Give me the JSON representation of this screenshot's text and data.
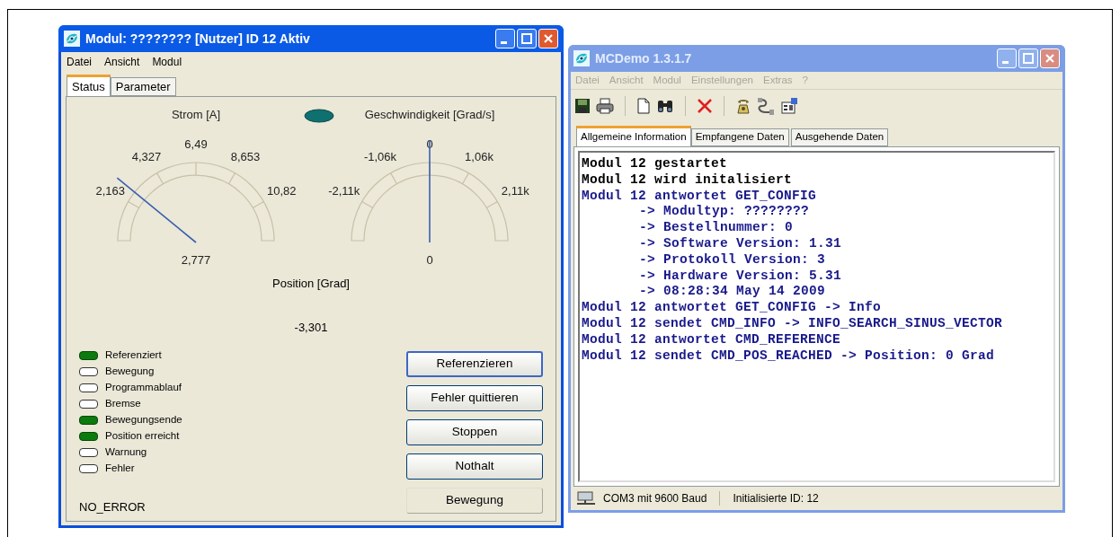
{
  "module_window": {
    "title": "Modul: ???????? [Nutzer] ID 12 Aktiv",
    "menu": [
      "Datei",
      "Ansicht",
      "Modul"
    ],
    "tabs": [
      {
        "label": "Status",
        "selected": true
      },
      {
        "label": "Parameter",
        "selected": false
      }
    ],
    "gauges": [
      {
        "title": "Strom [A]",
        "ticks": [
          "2,163",
          "4,327",
          "6,49",
          "8,653",
          "10,82"
        ],
        "value": "2,777",
        "level": 0.214
      },
      {
        "title": "Geschwindigkeit [Grad/s]",
        "ticks": [
          "-2,11k",
          "-1,06k",
          "0",
          "1,06k",
          "2,11k"
        ],
        "value": "0",
        "level": 0.5
      }
    ],
    "position": {
      "label": "Position [Grad]",
      "value": "-3,301"
    },
    "indicators": [
      {
        "label": "Referenziert",
        "on": true
      },
      {
        "label": "Bewegung",
        "on": false
      },
      {
        "label": "Programmablauf",
        "on": false
      },
      {
        "label": "Bremse",
        "on": false
      },
      {
        "label": "Bewegungsende",
        "on": true
      },
      {
        "label": "Position erreicht",
        "on": true
      },
      {
        "label": "Warnung",
        "on": false
      },
      {
        "label": "Fehler",
        "on": false
      }
    ],
    "buttons": [
      {
        "label": "Referenzieren",
        "kind": "focused"
      },
      {
        "label": "Fehler quittieren",
        "kind": "normal"
      },
      {
        "label": "Stoppen",
        "kind": "normal"
      },
      {
        "label": "Nothalt",
        "kind": "normal"
      },
      {
        "label": "Bewegung",
        "kind": "flat"
      }
    ],
    "error_status": "NO_ERROR"
  },
  "app_window": {
    "title": "MCDemo 1.3.1.7",
    "menu": [
      "Datei",
      "Ansicht",
      "Modul",
      "Einstellungen",
      "Extras",
      "?"
    ],
    "tabs": [
      {
        "label": "Allgemeine Information",
        "selected": true
      },
      {
        "label": "Empfangene Daten",
        "selected": false
      },
      {
        "label": "Ausgehende Daten",
        "selected": false
      }
    ],
    "log": [
      {
        "text": "Modul 12 gestartet",
        "color": "#000000"
      },
      {
        "text": "Modul 12 wird initalisiert",
        "color": "#000000"
      },
      {
        "text": "Modul 12 antwortet GET_CONFIG",
        "color": "#1a1a8c",
        "children": [
          {
            "text": "-> Modultyp: ????????",
            "color": "#1a1a8c"
          },
          {
            "text": "-> Bestellnummer: 0",
            "color": "#1a1a8c"
          },
          {
            "text": "-> Software Version: 1.31",
            "color": "#1a1a8c"
          },
          {
            "text": "-> Protokoll Version: 3",
            "color": "#1a1a8c"
          },
          {
            "text": "-> Hardware Version: 5.31",
            "color": "#1a1a8c"
          },
          {
            "text": "-> 08:28:34 May 14 2009",
            "color": "#1a1a8c"
          }
        ]
      },
      {
        "text": "Modul 12 antwortet GET_CONFIG -> Info",
        "color": "#1a1a8c"
      },
      {
        "text": "Modul 12 sendet CMD_INFO -> INFO_SEARCH_SINUS_VECTOR",
        "color": "#1a1a8c"
      },
      {
        "text": "Modul 12 antwortet CMD_REFERENCE",
        "color": "#1a1a8c"
      },
      {
        "text": "Modul 12 sendet CMD_POS_REACHED -> Position: 0 Grad",
        "color": "#1a1a8c"
      }
    ],
    "status_bar": {
      "connection": "COM3 mit 9600 Baud",
      "id": "Initialisierte ID: 12"
    }
  }
}
